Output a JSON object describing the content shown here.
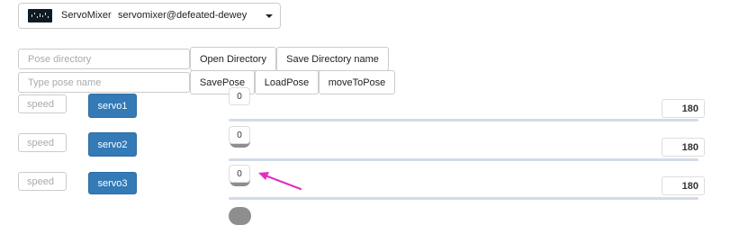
{
  "app_selector": {
    "app_name": "ServoMixer",
    "user": "servomixer@defeated-dewey"
  },
  "directory": {
    "pose_directory_placeholder": "Pose directory",
    "open_label": "Open Directory",
    "save_label": "Save Directory name"
  },
  "pose": {
    "pose_name_placeholder": "Type pose name",
    "save_label": "SavePose",
    "load_label": "LoadPose",
    "move_label": "moveToPose"
  },
  "servos": [
    {
      "label": "servo1",
      "speed_placeholder": "speed",
      "min": "0",
      "max": "180"
    },
    {
      "label": "servo2",
      "speed_placeholder": "speed",
      "min": "0",
      "max": "180"
    },
    {
      "label": "servo3",
      "speed_placeholder": "speed",
      "min": "0",
      "max": "180"
    }
  ],
  "colors": {
    "servo_button": "#337ab7",
    "arrow_annotation": "#e030c0",
    "slider_track": "#d2dbe8",
    "slider_knob": "#8e8e8e"
  }
}
